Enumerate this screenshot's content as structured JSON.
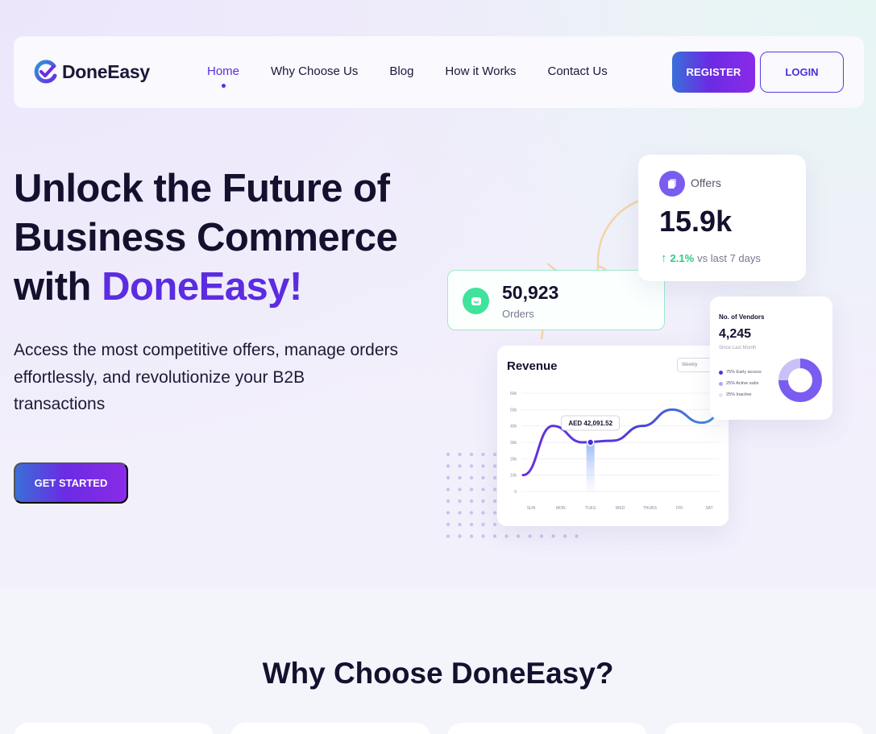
{
  "brand": {
    "name": "DoneEasy"
  },
  "nav": {
    "links": [
      {
        "label": "Home",
        "active": true
      },
      {
        "label": "Why Choose Us",
        "active": false
      },
      {
        "label": "Blog",
        "active": false
      },
      {
        "label": "How it Works",
        "active": false
      },
      {
        "label": "Contact Us",
        "active": false
      }
    ],
    "register_label": "REGISTER",
    "login_label": "LOGIN"
  },
  "hero": {
    "title_line1": "Unlock the Future of",
    "title_line2": "Business Commerce",
    "title_line3_prefix": "with ",
    "title_accent": "DoneEasy!",
    "description": "Access the most competitive offers, manage orders effortlessly, and revolutionize your B2B transactions",
    "cta_label": "GET STARTED"
  },
  "offers_card": {
    "label": "Offers",
    "value": "15.9k",
    "change_pct": "2.1%",
    "change_text": "vs last 7 days"
  },
  "orders_card": {
    "value": "50,923",
    "label": "Orders"
  },
  "revenue_card": {
    "title": "Revenue",
    "period": "Weekly",
    "tooltip": "AED 42,091.52"
  },
  "vendors_card": {
    "title": "No. of Vendors",
    "value": "4,245",
    "subtitle": "Since Last Month",
    "legend": [
      {
        "label": "75% Early access",
        "color": "#5b2ce0"
      },
      {
        "label": "25% Active subs",
        "color": "#b3a6f3"
      },
      {
        "label": "25% Inactive",
        "color": "#e6e3f6"
      }
    ]
  },
  "chart_data": [
    {
      "type": "line",
      "title": "Revenue",
      "categories": [
        "SUN",
        "MON",
        "TUES",
        "WED",
        "THURS",
        "FRI",
        "SAT"
      ],
      "y_ticks": [
        "60k",
        "50k",
        "40k",
        "30k",
        "20k",
        "10k",
        "0"
      ],
      "ylim": [
        0,
        60
      ],
      "series": [
        {
          "values": [
            10,
            40,
            30,
            31,
            40,
            50,
            42,
            53
          ]
        }
      ],
      "highlight_category": "TUES",
      "highlight_label": "AED 42,091.52",
      "colors": {
        "line_start": "#6a2ee0",
        "line_end": "#3fa6d8"
      }
    },
    {
      "type": "pie",
      "title": "No. of Vendors",
      "values": [
        75,
        25
      ],
      "colors": [
        "#7a5cf0",
        "#c9c0f6"
      ]
    }
  ],
  "section": {
    "title": "Why Choose DoneEasy?"
  },
  "colors": {
    "brand_purple": "#5b2ce0",
    "gradient_start": "#3a6fd8",
    "gradient_end": "#8a2be8",
    "success": "#2cc88a",
    "dark_text": "#14112e"
  }
}
